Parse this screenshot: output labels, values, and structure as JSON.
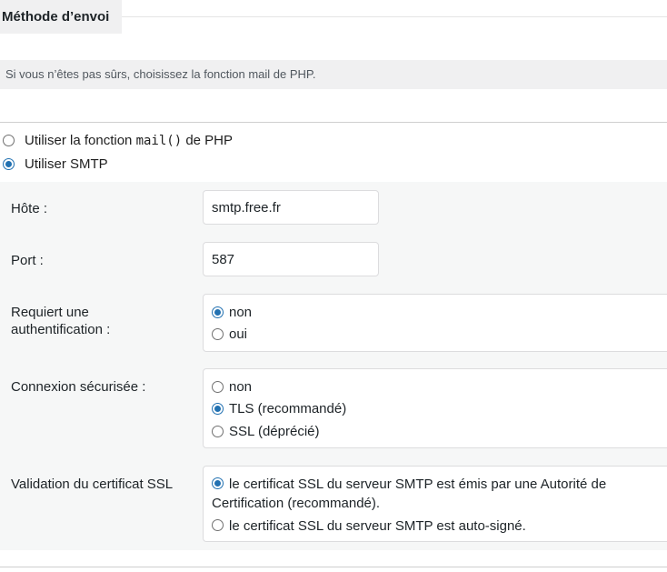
{
  "section": {
    "title": "Méthode d’envoi"
  },
  "notice": {
    "text": "Si vous n’êtes pas sûrs, choisissez la fonction mail de PHP."
  },
  "method": {
    "options": [
      {
        "prefix": "Utiliser la fonction",
        "code": "mail()",
        "suffix": "de PHP",
        "checked": false
      },
      {
        "label": "Utiliser SMTP",
        "checked": true
      }
    ]
  },
  "smtp": {
    "host": {
      "label": "Hôte :",
      "value": "smtp.free.fr"
    },
    "port": {
      "label": "Port :",
      "value": "587"
    },
    "auth": {
      "label_line1": "Requiert une",
      "label_line2": "authentification :",
      "options": [
        {
          "label": "non",
          "checked": true
        },
        {
          "label": "oui",
          "checked": false
        }
      ]
    },
    "secure": {
      "label": "Connexion sécurisée :",
      "options": [
        {
          "label": "non",
          "checked": false
        },
        {
          "label": "TLS (recommandé)",
          "checked": true
        },
        {
          "label": "SSL (déprécié)",
          "checked": false
        }
      ]
    },
    "ssl_validation": {
      "label": "Validation du certificat SSL",
      "options": [
        {
          "label": "le certificat SSL du serveur SMTP est émis par une Autorité de Certification (recommandé).",
          "checked": true
        },
        {
          "label": "le certificat SSL du serveur SMTP est auto-signé.",
          "checked": false
        }
      ]
    }
  },
  "colors": {
    "accent": "#2271b1",
    "panel": "#f6f7f7",
    "notice_bg": "#f0f0f1"
  }
}
